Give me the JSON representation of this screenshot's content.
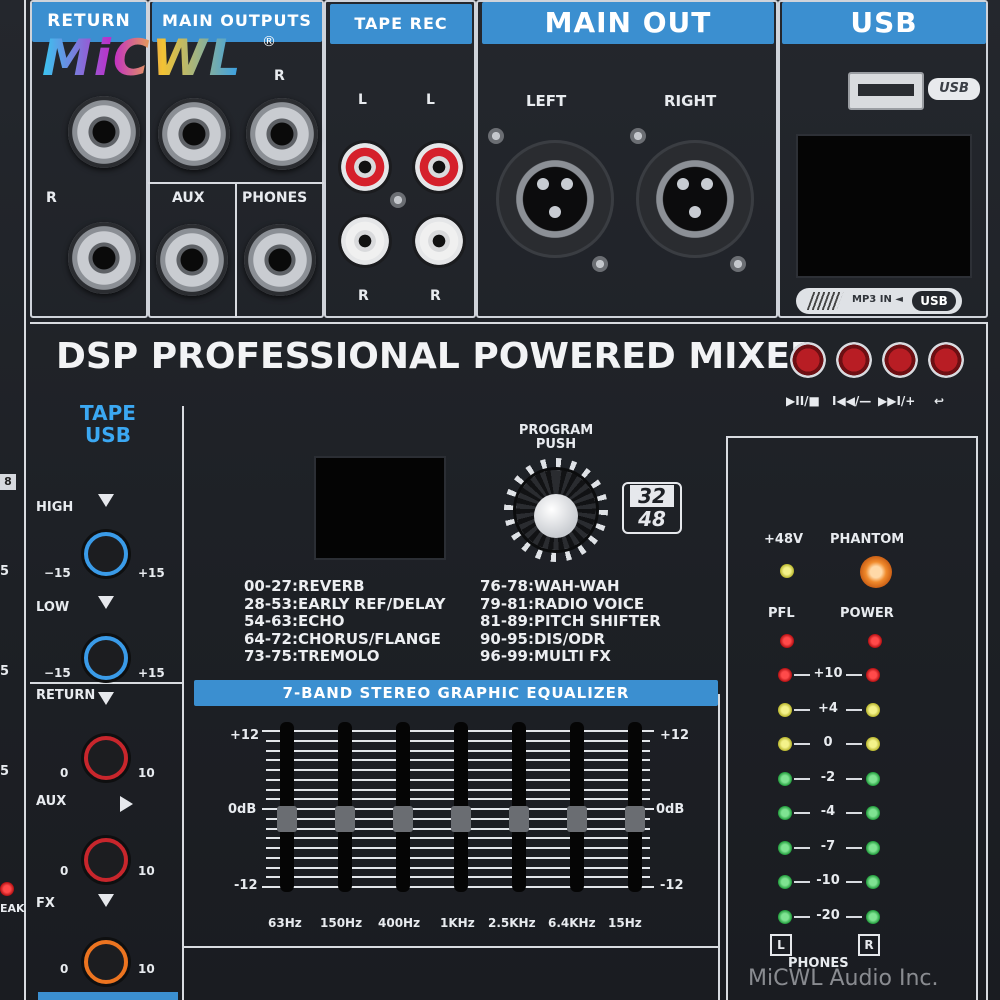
{
  "brand": {
    "logo_text": "MiCWL",
    "registered": "®",
    "watermark": "MiCWL Audio Inc."
  },
  "headers": {
    "return": "RETURN",
    "main_outputs": "MAIN OUTPUTS",
    "tape_rec": "TAPE  REC",
    "main_out": "MAIN OUT",
    "usb": "USB"
  },
  "jack_labels": {
    "return_r": "R",
    "main_r": "R",
    "aux": "AUX",
    "phones": "PHONES"
  },
  "tape_rec": {
    "l1": "L",
    "l2": "L",
    "r1": "R",
    "r2": "R"
  },
  "main_out": {
    "left": "LEFT",
    "right": "RIGHT"
  },
  "usb": {
    "badge": "USB",
    "mp3_in": "MP3 IN ◄",
    "usb_badge": "USB"
  },
  "title": "DSP PROFESSIONAL POWERED MIXER",
  "player_buttons": [
    {
      "label": "▶II/■"
    },
    {
      "label": "I◀◀/—"
    },
    {
      "label": "▶▶I/+"
    },
    {
      "label": "↩"
    }
  ],
  "tape_usb": {
    "title_line1": "TAPE",
    "title_line2": "USB",
    "high": {
      "label": "HIGH",
      "min": "−15",
      "max": "+15"
    },
    "low": {
      "label": "LOW",
      "min": "−15",
      "max": "+15"
    }
  },
  "left_knobs": {
    "return": {
      "label": "RETURN",
      "min": "0",
      "max": "10"
    },
    "aux": {
      "label": "AUX",
      "min": "0",
      "max": "10"
    },
    "fx": {
      "label": "FX",
      "min": "0",
      "max": "10"
    }
  },
  "left_edge": {
    "n1": "8",
    "n2": "5",
    "n3": "5",
    "n4": "5",
    "peak": "EAK"
  },
  "dsp": {
    "program_line1": "PROGRAM",
    "program_line2": "PUSH",
    "bit_badge_top": "32",
    "bit_badge_bottom": "48",
    "effects_left": [
      "00-27:REVERB",
      "28-53:EARLY REF/DELAY",
      "54-63:ECHO",
      "64-72:CHORUS/FLANGE",
      "73-75:TREMOLO"
    ],
    "effects_right": [
      "76-78:WAH-WAH",
      "79-81:RADIO VOICE",
      "81-89:PITCH SHIFTER",
      "90-95:DIS/ODR",
      "96-99:MULTI FX"
    ]
  },
  "eq": {
    "title": "7-BAND  STEREO  GRAPHIC  EQUALIZER",
    "scale_top": "+12",
    "scale_mid": "0dB",
    "scale_bottom": "-12",
    "scale_top_right": "+12",
    "scale_mid_right": "0dB",
    "scale_bottom_right": "-12",
    "bands": [
      "63Hz",
      "150Hz",
      "400Hz",
      "1KHz",
      "2.5KHz",
      "6.4KHz",
      "15Hz"
    ]
  },
  "meter": {
    "v48": "+48V",
    "phantom": "PHANTOM",
    "pfl": "PFL",
    "power": "POWER",
    "levels": [
      "+10",
      "+4",
      "0",
      "-2",
      "-4",
      "-7",
      "-10",
      "-20"
    ],
    "l": "L",
    "r": "R",
    "phones": "PHONES"
  }
}
